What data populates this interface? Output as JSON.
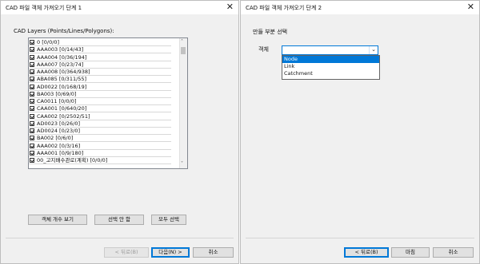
{
  "window1": {
    "title": "CAD 파일 객체 가져오기 단계 1",
    "close_glyph": "✕",
    "layers_label": "CAD Layers (Points/Lines/Polygons):",
    "layers": [
      "0 [0/0/0]",
      "AAA003 [0/14/43]",
      "AAA004 [0/36/194]",
      "AAA007 [0/23/74]",
      "AAA008 [0/364/938]",
      "ABA085 [0/311/55]",
      "AD0022 [0/168/19]",
      "BA003 [0/69/0]",
      "CA0011 [0/0/0]",
      "CAA001 [0/640/20]",
      "CAA002 [0/2502/51]",
      "AD0023 [0/26/0]",
      "AD0024 [0/23/0]",
      "BA002 [0/6/0]",
      "AAA002 [0/3/16]",
      "AAA001 [0/9/180]",
      "00_고지배수관로(계획) [0/0/0]"
    ],
    "scroll_up": "˄",
    "scroll_down": "˅",
    "btn_count": "객체 개수 보기",
    "btn_deselect": "선택 안 함",
    "btn_select_all": "모두 선택",
    "btn_back": "< 뒤로(B)",
    "btn_next": "다음(N) >",
    "btn_cancel": "취소"
  },
  "window2": {
    "title": "CAD 파일 객체 가져오기 단계 2",
    "close_glyph": "✕",
    "section_label": "만들 부분 선택",
    "object_label": "객체",
    "combo_value": "",
    "dropdown_glyph": "⌄",
    "options": [
      "Node",
      "Link",
      "Catchment"
    ],
    "selected_option": "Node",
    "btn_back": "< 뒤로(B)",
    "btn_finish": "마침",
    "btn_cancel": "취소"
  },
  "colors": {
    "accent": "#0078d7",
    "window_bg": "#f0f0f0",
    "button_bg": "#e1e1e1"
  }
}
